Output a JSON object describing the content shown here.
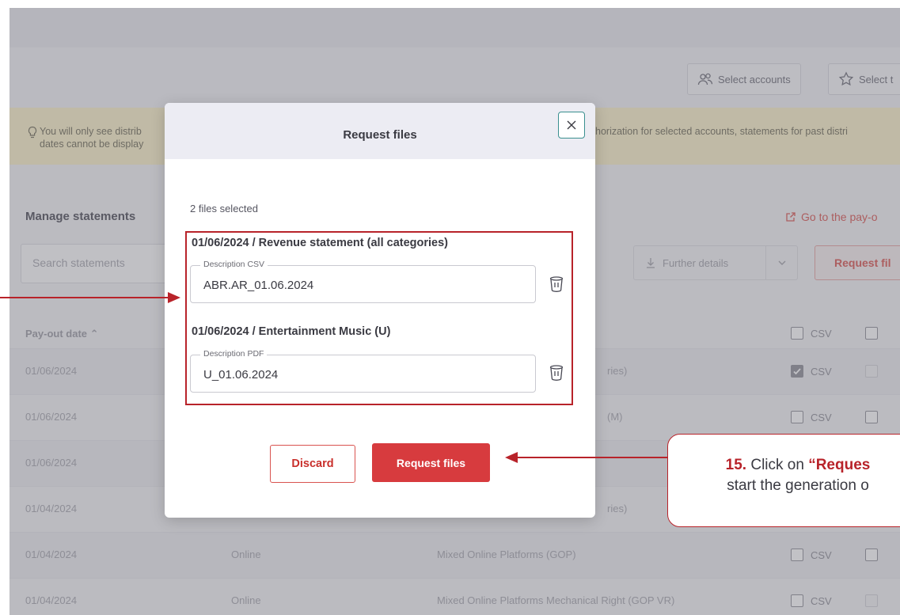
{
  "toolbar": {
    "select_accounts_label": "Select accounts",
    "select_t_label": "Select t"
  },
  "notice": {
    "line1": "You will only see distrib",
    "line2": "dates cannot be display",
    "line1_right": "horization for selected accounts, statements for past distri"
  },
  "manage": {
    "title": "Manage statements",
    "goto_label": "Go to the pay-o",
    "search_placeholder": "Search statements",
    "further_label": "Further details",
    "request_label": "Request fil"
  },
  "table": {
    "header_pay": "Pay-out date",
    "header_csv": "CSV",
    "rows": [
      {
        "date": "01/06/2024",
        "platform": "",
        "desc": "ries)",
        "csv": "CSV",
        "csv_checked": true,
        "second_dim": true
      },
      {
        "date": "01/06/2024",
        "platform": "",
        "desc": "(M)",
        "csv": "CSV",
        "csv_checked": false,
        "second_dim": false
      },
      {
        "date": "01/06/2024",
        "platform": "",
        "desc": "",
        "csv": "",
        "csv_checked": false,
        "second_dim": false
      },
      {
        "date": "01/04/2024",
        "platform": "",
        "desc": "ries)",
        "csv": "",
        "csv_checked": false,
        "second_dim": false
      },
      {
        "date": "01/04/2024",
        "platform": "Online",
        "desc": "Mixed Online Platforms (GOP)",
        "csv": "CSV",
        "csv_checked": false,
        "second_dim": false
      },
      {
        "date": "01/04/2024",
        "platform": "Online",
        "desc": "Mixed Online Platforms Mechanical Right (GOP VR)",
        "csv": "CSV",
        "csv_checked": false,
        "second_dim": true
      }
    ]
  },
  "modal": {
    "title": "Request files",
    "selected_count": "2 files selected",
    "files": [
      {
        "title": "01/06/2024 / Revenue statement (all categories)",
        "field_label": "Description CSV",
        "value": "ABR.AR_01.06.2024"
      },
      {
        "title": "01/06/2024 / Entertainment Music (U)",
        "field_label": "Description PDF",
        "value": "U_01.06.2024"
      }
    ],
    "discard_label": "Discard",
    "request_label": "Request files"
  },
  "callout": {
    "step": "15.",
    "line1_pre": "Click on",
    "line1_highlight": "“Reques",
    "line2": "start the generation o"
  },
  "colors": {
    "accent_red": "#d73b3e",
    "annotation_red": "#b8232a",
    "close_teal": "#3a8f8f",
    "notice_yellow": "#fbf2c9"
  }
}
